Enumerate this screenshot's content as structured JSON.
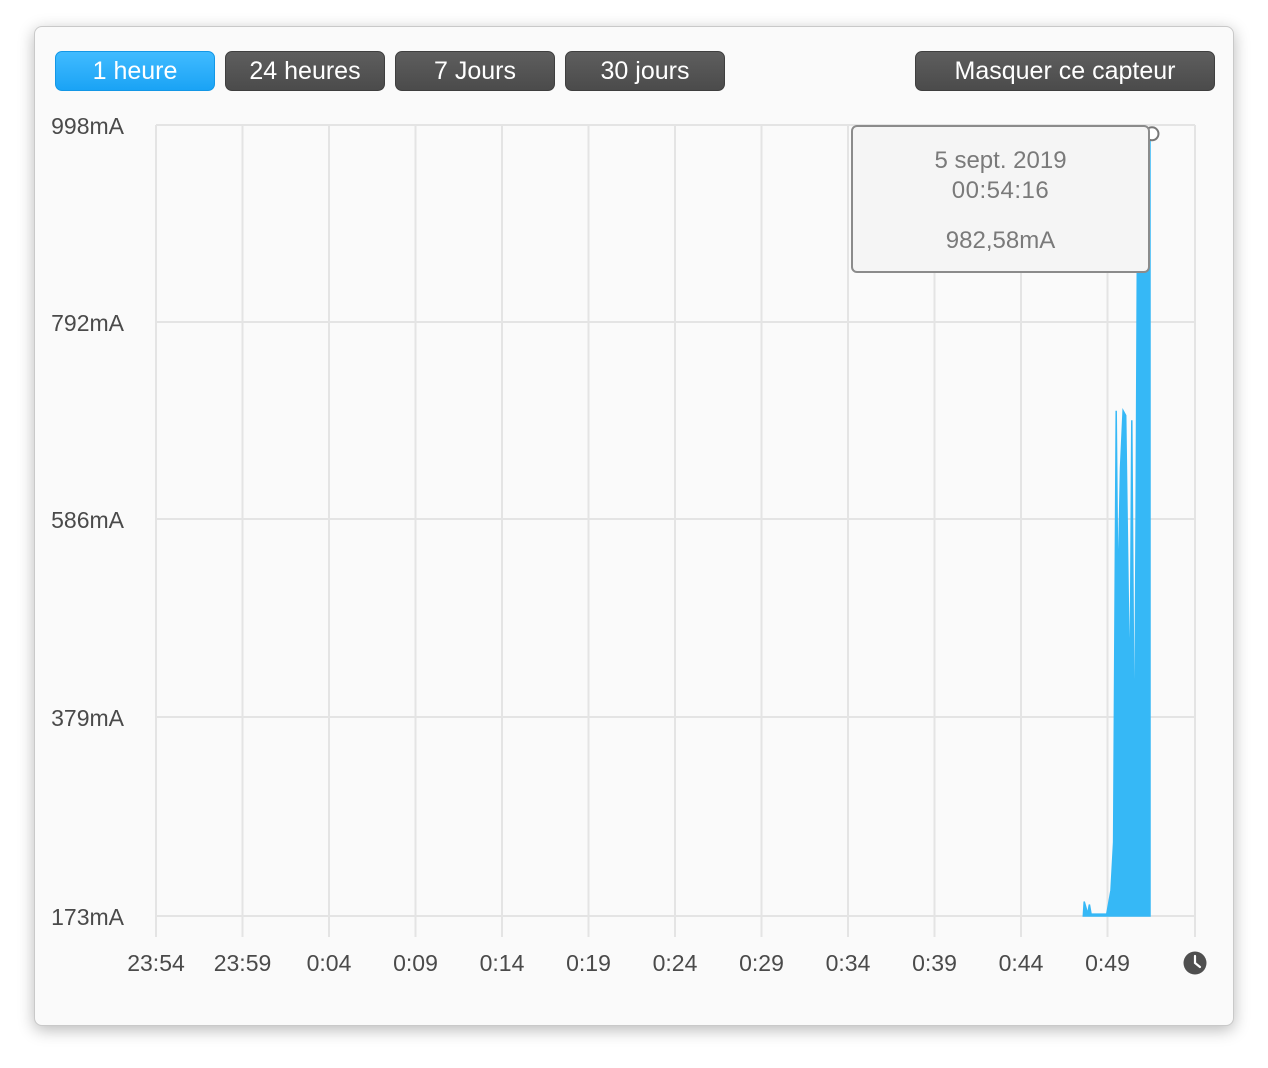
{
  "range_buttons": [
    {
      "label": "1 heure",
      "active": true
    },
    {
      "label": "24 heures",
      "active": false
    },
    {
      "label": "7 Jours",
      "active": false
    },
    {
      "label": "30 jours",
      "active": false
    }
  ],
  "hide_sensor_label": "Masquer ce capteur",
  "tooltip": {
    "date": "5 sept. 2019",
    "time": "00:54:16",
    "value": "982,58mA"
  },
  "colors": {
    "series": "#36b8f6",
    "active_button": "#1aa3f5",
    "button": "#555555",
    "grid": "#e4e4e4"
  },
  "chart_data": {
    "type": "area",
    "y_ticks": [
      "998mA",
      "792mA",
      "586mA",
      "379mA",
      "173mA"
    ],
    "x_ticks": [
      "23:54",
      "23:59",
      "0:04",
      "0:09",
      "0:14",
      "0:19",
      "0:24",
      "0:29",
      "0:34",
      "0:39",
      "0:44",
      "0:49"
    ],
    "x_end_icon": "clock-icon",
    "ylim": [
      173,
      998
    ],
    "x_unit": "minutes",
    "xlim": [
      0,
      60
    ],
    "grid": true,
    "legend": "none",
    "series": [
      {
        "points": [
          [
            53.55,
            173
          ],
          [
            53.6,
            188
          ],
          [
            53.7,
            182
          ],
          [
            53.8,
            175
          ],
          [
            53.9,
            185
          ],
          [
            54.0,
            175
          ],
          [
            54.3,
            175
          ],
          [
            54.6,
            175
          ],
          [
            54.9,
            175
          ],
          [
            55.05,
            190
          ],
          [
            55.15,
            200
          ],
          [
            55.3,
            250
          ],
          [
            55.45,
            700
          ],
          [
            55.55,
            500
          ],
          [
            55.7,
            640
          ],
          [
            55.85,
            700
          ],
          [
            56.0,
            695
          ],
          [
            56.15,
            500
          ],
          [
            56.25,
            400
          ],
          [
            56.35,
            690
          ],
          [
            56.5,
            300
          ],
          [
            56.6,
            590
          ],
          [
            56.7,
            980
          ],
          [
            56.85,
            990
          ],
          [
            57.0,
            985
          ],
          [
            57.1,
            995
          ],
          [
            57.2,
            990
          ],
          [
            57.3,
            985
          ],
          [
            57.4,
            983
          ]
        ]
      }
    ],
    "hover_point": [
      57.4,
      982.58
    ]
  }
}
